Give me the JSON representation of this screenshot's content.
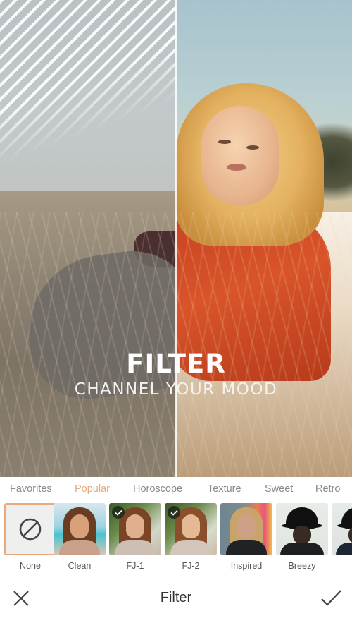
{
  "preview": {
    "headline": "FILTER",
    "subline": "CHANNEL YOUR MOOD"
  },
  "categories": {
    "active_index": 1,
    "active_color": "#e9a97c",
    "items": [
      {
        "label": "Favorites"
      },
      {
        "label": "Popular"
      },
      {
        "label": "Horoscope"
      },
      {
        "label": "Texture"
      },
      {
        "label": "Sweet"
      },
      {
        "label": "Retro"
      }
    ]
  },
  "filters": {
    "selected_index": 0,
    "items": [
      {
        "label": "None",
        "icon": "no-filter-icon"
      },
      {
        "label": "Clean"
      },
      {
        "label": "FJ-1",
        "badge": "check"
      },
      {
        "label": "FJ-2",
        "badge": "check"
      },
      {
        "label": "Inspired"
      },
      {
        "label": "Breezy"
      },
      {
        "label": "N"
      }
    ]
  },
  "bottom_bar": {
    "title": "Filter",
    "close_icon": "close-icon",
    "confirm_icon": "checkmark-icon"
  }
}
